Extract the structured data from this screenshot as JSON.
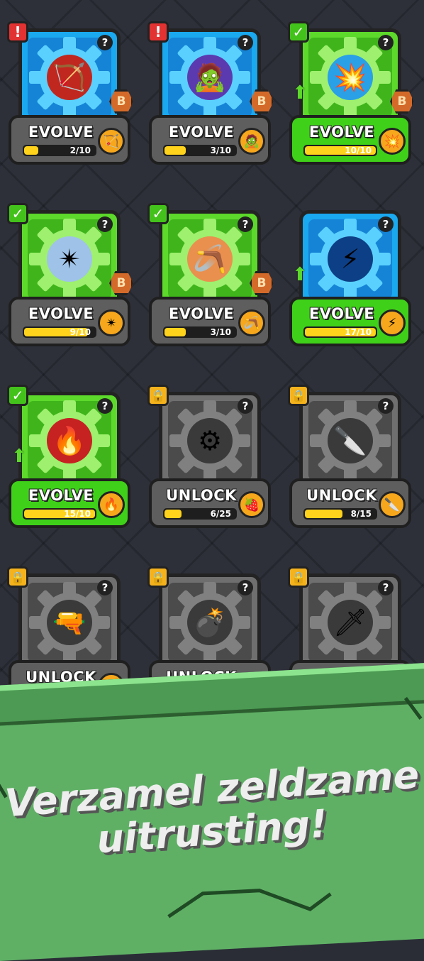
{
  "cards": [
    {
      "frame": "blue",
      "badge": "!",
      "badge_type": "alert",
      "show_b": true,
      "b_label": "B",
      "label": "EVOLVE",
      "plate": "grey",
      "progress": "2/10",
      "fill": 0.2,
      "glyph": "🏹",
      "glyph_bg": "#c0281f",
      "mini": "🏹",
      "arrow": false
    },
    {
      "frame": "blue",
      "badge": "!",
      "badge_type": "alert",
      "show_b": true,
      "b_label": "B",
      "label": "EVOLVE",
      "plate": "grey",
      "progress": "3/10",
      "fill": 0.3,
      "glyph": "🧟",
      "glyph_bg": "#5b3ab0",
      "mini": "🧟",
      "arrow": false
    },
    {
      "frame": "green",
      "badge": "✓",
      "badge_type": "check",
      "show_b": true,
      "b_label": "B",
      "label": "EVOLVE",
      "plate": "green",
      "progress": "10/10",
      "fill": 1.0,
      "glyph": "💥",
      "glyph_bg": "#2aa0e6",
      "mini": "💥",
      "arrow": true
    },
    {
      "frame": "green",
      "badge": "✓",
      "badge_type": "check",
      "show_b": true,
      "b_label": "B",
      "label": "EVOLVE",
      "plate": "grey",
      "progress": "9/10",
      "fill": 0.9,
      "glyph": "✴",
      "glyph_bg": "#9fc3e8",
      "mini": "✴",
      "arrow": false
    },
    {
      "frame": "green",
      "badge": "✓",
      "badge_type": "check",
      "show_b": true,
      "b_label": "B",
      "label": "EVOLVE",
      "plate": "grey",
      "progress": "3/10",
      "fill": 0.3,
      "glyph": "🪃",
      "glyph_bg": "#e9904e",
      "mini": "🪃",
      "arrow": false
    },
    {
      "frame": "blue",
      "badge": "",
      "badge_type": "none",
      "show_b": false,
      "b_label": "",
      "label": "EVOLVE",
      "plate": "green",
      "progress": "17/10",
      "fill": 1.0,
      "glyph": "⚡",
      "glyph_bg": "#0d3f86",
      "mini": "⚡",
      "arrow": true
    },
    {
      "frame": "green",
      "badge": "✓",
      "badge_type": "check",
      "show_b": false,
      "b_label": "",
      "label": "EVOLVE",
      "plate": "green",
      "progress": "15/10",
      "fill": 1.0,
      "glyph": "🔥",
      "glyph_bg": "#c62222",
      "mini": "🔥",
      "arrow": true
    },
    {
      "frame": "grey",
      "badge": "🔒",
      "badge_type": "lock",
      "show_b": false,
      "b_label": "",
      "label": "UNLOCK",
      "plate": "grey",
      "progress": "6/25",
      "fill": 0.24,
      "glyph": "⚙",
      "glyph_bg": "#3a3a3a",
      "mini": "🍓",
      "arrow": false
    },
    {
      "frame": "grey",
      "badge": "🔒",
      "badge_type": "lock",
      "show_b": false,
      "b_label": "",
      "label": "UNLOCK",
      "plate": "grey",
      "progress": "8/15",
      "fill": 0.53,
      "glyph": "🔪",
      "glyph_bg": "#3a3a3a",
      "mini": "🔪",
      "arrow": false
    },
    {
      "frame": "grey",
      "badge": "🔒",
      "badge_type": "lock",
      "show_b": false,
      "b_label": "",
      "label": "UNLOCK",
      "plate": "grey",
      "progress": "",
      "fill": 0,
      "glyph": "🔫",
      "glyph_bg": "#3a3a3a",
      "mini": "",
      "arrow": false
    },
    {
      "frame": "grey",
      "badge": "🔒",
      "badge_type": "lock",
      "show_b": false,
      "b_label": "",
      "label": "UNLOCK",
      "plate": "grey",
      "progress": "",
      "fill": 0,
      "glyph": "💣",
      "glyph_bg": "#3a3a3a",
      "mini": "",
      "arrow": false
    },
    {
      "frame": "grey",
      "badge": "🔒",
      "badge_type": "lock",
      "show_b": false,
      "b_label": "",
      "label": "",
      "plate": "grey",
      "progress": "",
      "fill": 0,
      "glyph": "🗡",
      "glyph_bg": "#3a3a3a",
      "mini": "",
      "arrow": false
    }
  ],
  "help_label": "?",
  "slogan": {
    "line1": "Verzamel zeldzame",
    "line2": "uitrusting!"
  },
  "colors": {
    "accent_green": "#3fd119",
    "accent_blue": "#1aa8ee",
    "progress_yellow": "#ffd21c",
    "banner_green": "#5fb065"
  }
}
